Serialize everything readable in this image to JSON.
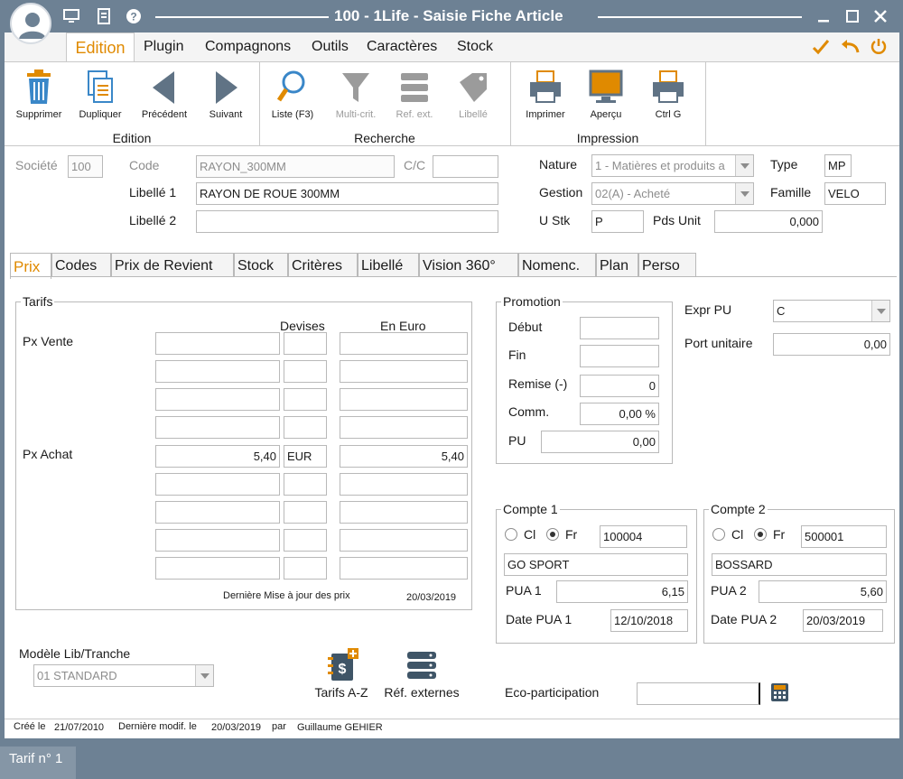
{
  "window": {
    "title": "100 - 1Life - Saisie Fiche Article"
  },
  "menu": {
    "items": [
      "Edition",
      "Plugin",
      "Compagnons",
      "Outils",
      "Caractères",
      "Stock"
    ]
  },
  "ribbon": {
    "edition": {
      "label": "Edition",
      "buttons": [
        "Supprimer",
        "Dupliquer",
        "Précédent",
        "Suivant"
      ]
    },
    "recherche": {
      "label": "Recherche",
      "buttons": [
        "Liste (F3)",
        "Multi-crit.",
        "Ref. ext.",
        "Libellé"
      ]
    },
    "impression": {
      "label": "Impression",
      "buttons": [
        "Imprimer",
        "Aperçu",
        "Ctrl G"
      ]
    }
  },
  "header": {
    "societe_label": "Société",
    "societe": "100",
    "code_label": "Code",
    "code": "RAYON_300MM",
    "cc_label": "C/C",
    "cc": "",
    "libelle1_label": "Libellé 1",
    "libelle1": "RAYON DE ROUE 300MM",
    "libelle2_label": "Libellé 2",
    "libelle2": "",
    "nature_label": "Nature",
    "nature": "1 - Matières et produits a",
    "type_label": "Type",
    "type": "MP",
    "gestion_label": "Gestion",
    "gestion": "02(A) - Acheté",
    "famille_label": "Famille",
    "famille": "VELO",
    "ustk_label": "U Stk",
    "ustk": "P",
    "pdsunit_label": "Pds Unit",
    "pdsunit": "0,000"
  },
  "tabs": [
    "Prix",
    "Codes",
    "Prix de Revient",
    "Stock",
    "Critères",
    "Libellé",
    "Vision 360°",
    "Nomenc.",
    "Plan",
    "Perso"
  ],
  "tarifs": {
    "title": "Tarifs",
    "col_devises": "Devises",
    "col_euro": "En Euro",
    "px_vente": "Px Vente",
    "px_achat": "Px Achat",
    "achat_prix": "5,40",
    "achat_devise": "EUR",
    "achat_euro": "5,40",
    "maj_label": "Dernière Mise à jour des prix",
    "maj_date": "20/03/2019"
  },
  "promotion": {
    "title": "Promotion",
    "debut_label": "Début",
    "debut": "",
    "fin_label": "Fin",
    "fin": "",
    "remise_label": "Remise (-)",
    "remise": "0",
    "comm_label": "Comm.",
    "comm": "0,00 %",
    "pu_label": "PU",
    "pu": "0,00"
  },
  "expr": {
    "label": "Expr PU",
    "value": "C",
    "port_label": "Port unitaire",
    "port": "0,00"
  },
  "compte1": {
    "title": "Compte 1",
    "cl": "Cl",
    "fr": "Fr",
    "code": "100004",
    "name": "GO SPORT",
    "pua_label": "PUA 1",
    "pua": "6,15",
    "date_label": "Date PUA 1",
    "date": "12/10/2018"
  },
  "compte2": {
    "title": "Compte 2",
    "cl": "Cl",
    "fr": "Fr",
    "code": "500001",
    "name": "BOSSARD",
    "pua_label": "PUA 2",
    "pua": "5,60",
    "date_label": "Date PUA 2",
    "date": "20/03/2019"
  },
  "modele": {
    "label": "Modèle Lib/Tranche",
    "value": "01 STANDARD"
  },
  "buttons": {
    "tarifs": "Tarifs A-Z",
    "refext": "Réf. externes"
  },
  "eco": {
    "label": "Eco-participation",
    "value": ""
  },
  "footer": {
    "cree_label": "Créé le",
    "cree": "21/07/2010",
    "modif_label": "Dernière modif. le",
    "modif": "20/03/2019",
    "par_label": "par",
    "user": "Guillaume GEHIER"
  },
  "status": {
    "tab": "Tarif n° 1"
  },
  "colors": {
    "accent": "#e08a00",
    "chrome": "#6d8194",
    "disabled": "#9b9b9b"
  }
}
